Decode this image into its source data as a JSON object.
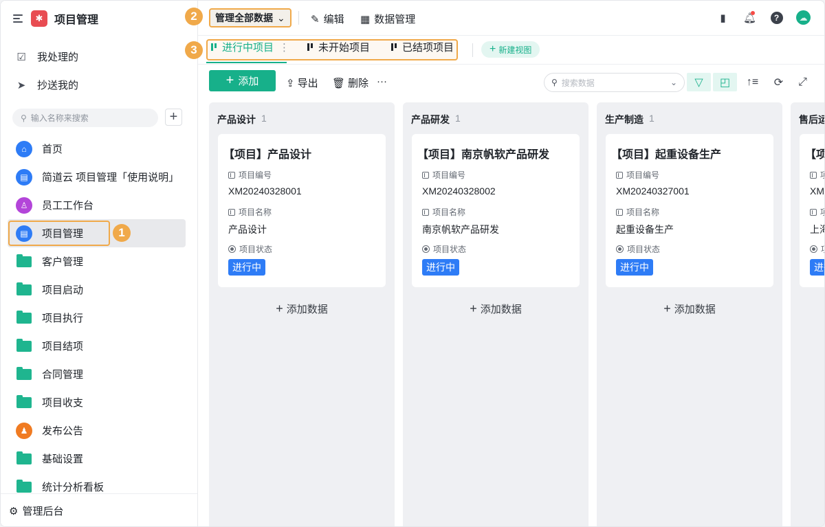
{
  "app": {
    "title": "项目管理"
  },
  "sidebar": {
    "quick": [
      {
        "label": "我处理的",
        "icon": "inbox-check-icon"
      },
      {
        "label": "抄送我的",
        "icon": "send-icon"
      }
    ],
    "search_placeholder": "输入名称来搜索",
    "items": [
      {
        "label": "首页",
        "icon": "home-icon",
        "color": "#2e7cf6"
      },
      {
        "label": "简道云 项目管理「使用说明」",
        "icon": "doc-icon",
        "color": "#2e7cf6"
      },
      {
        "label": "员工工作台",
        "icon": "user-icon",
        "color": "#b345d9"
      },
      {
        "label": "项目管理",
        "icon": "doc-icon",
        "color": "#2e7cf6",
        "active": true
      },
      {
        "label": "客户管理",
        "icon": "folder-icon"
      },
      {
        "label": "项目启动",
        "icon": "folder-icon"
      },
      {
        "label": "项目执行",
        "icon": "folder-icon"
      },
      {
        "label": "项目结项",
        "icon": "folder-icon"
      },
      {
        "label": "合同管理",
        "icon": "folder-icon"
      },
      {
        "label": "项目收支",
        "icon": "folder-icon"
      },
      {
        "label": "发布公告",
        "icon": "stamp-icon",
        "color": "#f07b22"
      },
      {
        "label": "基础设置",
        "icon": "folder-icon"
      },
      {
        "label": "统计分析看板",
        "icon": "folder-icon"
      }
    ],
    "admin": "管理后台"
  },
  "annotations": {
    "one": "1",
    "two": "2",
    "three": "3",
    "color": "#f0a94a"
  },
  "header": {
    "scope": "管理全部数据",
    "edit": "编辑",
    "data_manage": "数据管理"
  },
  "tabs": [
    {
      "label": "进行中项目",
      "active": true
    },
    {
      "label": "未开始项目"
    },
    {
      "label": "已结项项目"
    }
  ],
  "new_view": "新建视图",
  "toolbar": {
    "add": "添加",
    "export": "导出",
    "delete": "删除",
    "more": "···",
    "search_placeholder": "搜索数据"
  },
  "board": {
    "field_labels": {
      "code": "项目编号",
      "name": "项目名称",
      "status": "项目状态"
    },
    "add_data": "添加数据",
    "columns": [
      {
        "title": "产品设计",
        "count": "1",
        "card": {
          "title": "【项目】产品设计",
          "code": "XM20240328001",
          "name": "产品设计",
          "status": "进行中"
        }
      },
      {
        "title": "产品研发",
        "count": "1",
        "card": {
          "title": "【项目】南京帆软产品研发",
          "code": "XM20240328002",
          "name": "南京帆软产品研发",
          "status": "进行中"
        }
      },
      {
        "title": "生产制造",
        "count": "1",
        "card": {
          "title": "【项目】起重设备生产",
          "code": "XM20240327001",
          "name": "起重设备生产",
          "status": "进行中"
        }
      },
      {
        "title": "售后运",
        "count": "",
        "card": {
          "title": "【项",
          "code": "XM2",
          "name": "上海",
          "status": "进行中"
        }
      }
    ]
  },
  "colors": {
    "accent": "#17b08a",
    "status": "#2e7cf6"
  }
}
